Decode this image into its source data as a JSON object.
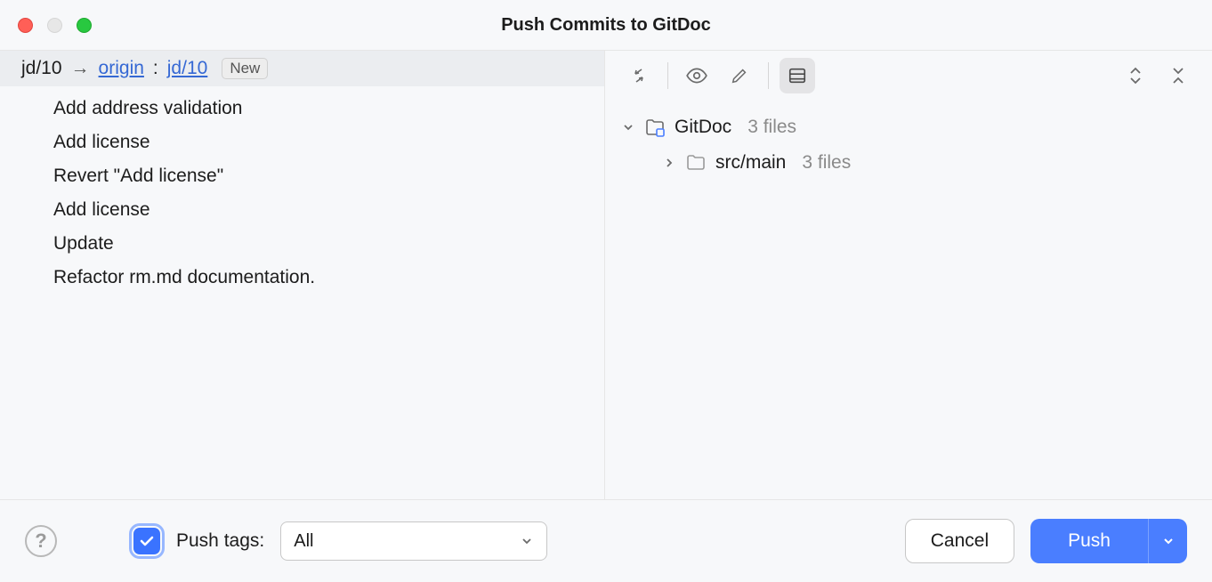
{
  "window": {
    "title": "Push Commits to GitDoc"
  },
  "branch": {
    "local": "jd/10",
    "remote": "origin",
    "remoteBranch": "jd/10",
    "badge": "New"
  },
  "commits": [
    "Add address validation",
    "Add license",
    "Revert \"Add license\"",
    "Add license",
    "Update",
    "Refactor rm.md documentation."
  ],
  "tree": {
    "root": {
      "name": "GitDoc",
      "count": "3 files"
    },
    "child": {
      "name": "src/main",
      "count": "3 files"
    }
  },
  "footer": {
    "pushTagsLabel": "Push tags:",
    "pushTagsValue": "All",
    "cancel": "Cancel",
    "push": "Push"
  }
}
